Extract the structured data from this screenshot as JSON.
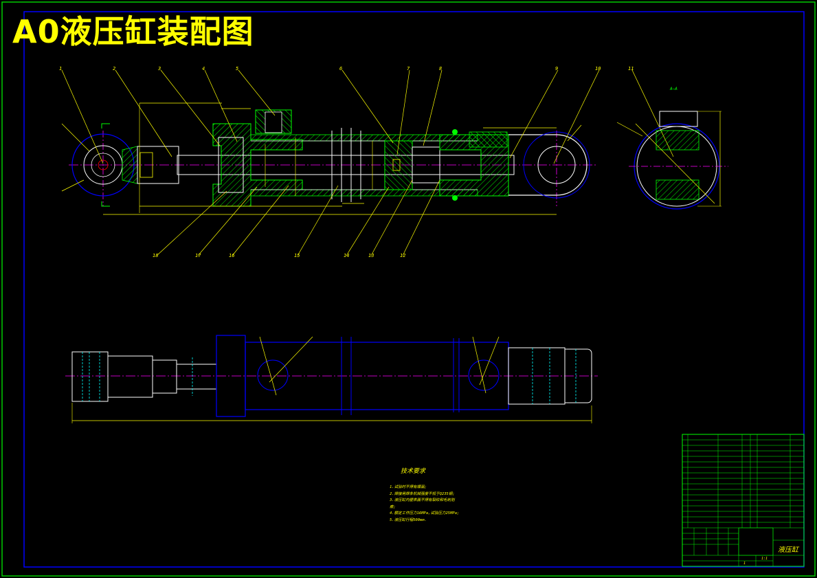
{
  "drawing": {
    "title": "A0液压缸装配图",
    "section_label": "A—A",
    "part_callouts": [
      "1",
      "2",
      "3",
      "4",
      "5",
      "6",
      "7",
      "8",
      "9",
      "10",
      "11",
      "12",
      "13",
      "14",
      "15",
      "16",
      "17",
      "18"
    ],
    "technical_requirements": {
      "heading": "技术要求",
      "lines": [
        "1.试验时不得有爆漏;",
        "2.焊接用焊条机械强度不低于Q235钢;",
        "3.液压缸内壁表面不得有裂纹和毛刺划",
        "痕;",
        "4.额定工作压力16MPa,试验压力25MPa;",
        "5.液压缸行程500mm."
      ]
    },
    "title_block": {
      "part_name": "液压缸",
      "scale": "1:1",
      "sheet": "1"
    },
    "colors": {
      "background": "#000000",
      "frame": "#0000ff",
      "outline": "#ffffff",
      "dimension": "#ffff00",
      "centerline": "#ff00ff",
      "hatch": "#00ff00",
      "hidden": "#00ffff",
      "title_block_lines": "#00ff00",
      "outer_border": "#00cc00"
    }
  }
}
